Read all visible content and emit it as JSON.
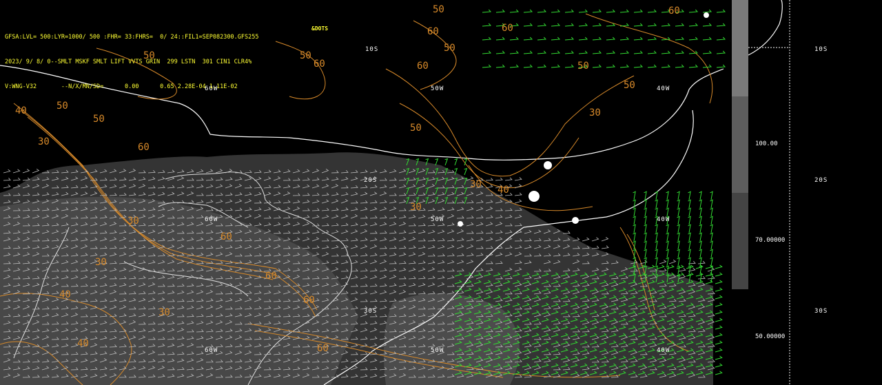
{
  "header": {
    "line1": "GFSA:LVL= 500:LYR=1000/ 500 :FHR= 33:FHRS=  0/ 24::FIL1=SEP082300.GFS255",
    "line2": "2023/ 9/ 8/ 0--SMLT MSKF SMLT LIFT VVTS GRIN  299 LSTN  301 CIN1 CLR4%",
    "line3": "V:WNG-V32       --N/X/MN/SD=      0.00      0.65 2.28E-04 1.11E-02",
    "tag": "&DOTS"
  },
  "grid_labels": {
    "lat_10s": "10S",
    "lat_20s": "20S",
    "lat_30s": "30S",
    "lon_60w": "60W",
    "lon_50w": "50W",
    "lon_40w": "40W"
  },
  "colorbar": {
    "labels": [
      "100.00",
      "70.00000",
      "50.00000"
    ],
    "bands": [
      "#7a7a7a",
      "#5d5d5d",
      "#444444"
    ],
    "right_lat_labels": [
      "10S",
      "20S",
      "30S"
    ]
  },
  "colors": {
    "background": "#000000",
    "contour": "#d88a2a",
    "barbs_white": "#bfbfbf",
    "barbs_green": "#33dd33",
    "coast": "#ffffff",
    "header_text": "#ffff33",
    "shade": "#3a3a3a"
  },
  "contour_labels": [
    {
      "t": "50"
    },
    {
      "t": "60"
    },
    {
      "t": "50"
    },
    {
      "t": "60"
    },
    {
      "t": "50"
    },
    {
      "t": "60"
    },
    {
      "t": "60"
    },
    {
      "t": "50"
    },
    {
      "t": "50"
    },
    {
      "t": "50"
    },
    {
      "t": "30"
    },
    {
      "t": "60"
    },
    {
      "t": "40"
    },
    {
      "t": "30"
    },
    {
      "t": "30"
    },
    {
      "t": "40"
    },
    {
      "t": "60"
    },
    {
      "t": "50"
    },
    {
      "t": "30"
    },
    {
      "t": "30"
    },
    {
      "t": "40"
    },
    {
      "t": "60"
    },
    {
      "t": "60"
    },
    {
      "t": "30"
    },
    {
      "t": "40"
    },
    {
      "t": "60"
    },
    {
      "t": "50"
    },
    {
      "t": "60"
    },
    {
      "t": "50"
    },
    {
      "t": "30"
    }
  ]
}
